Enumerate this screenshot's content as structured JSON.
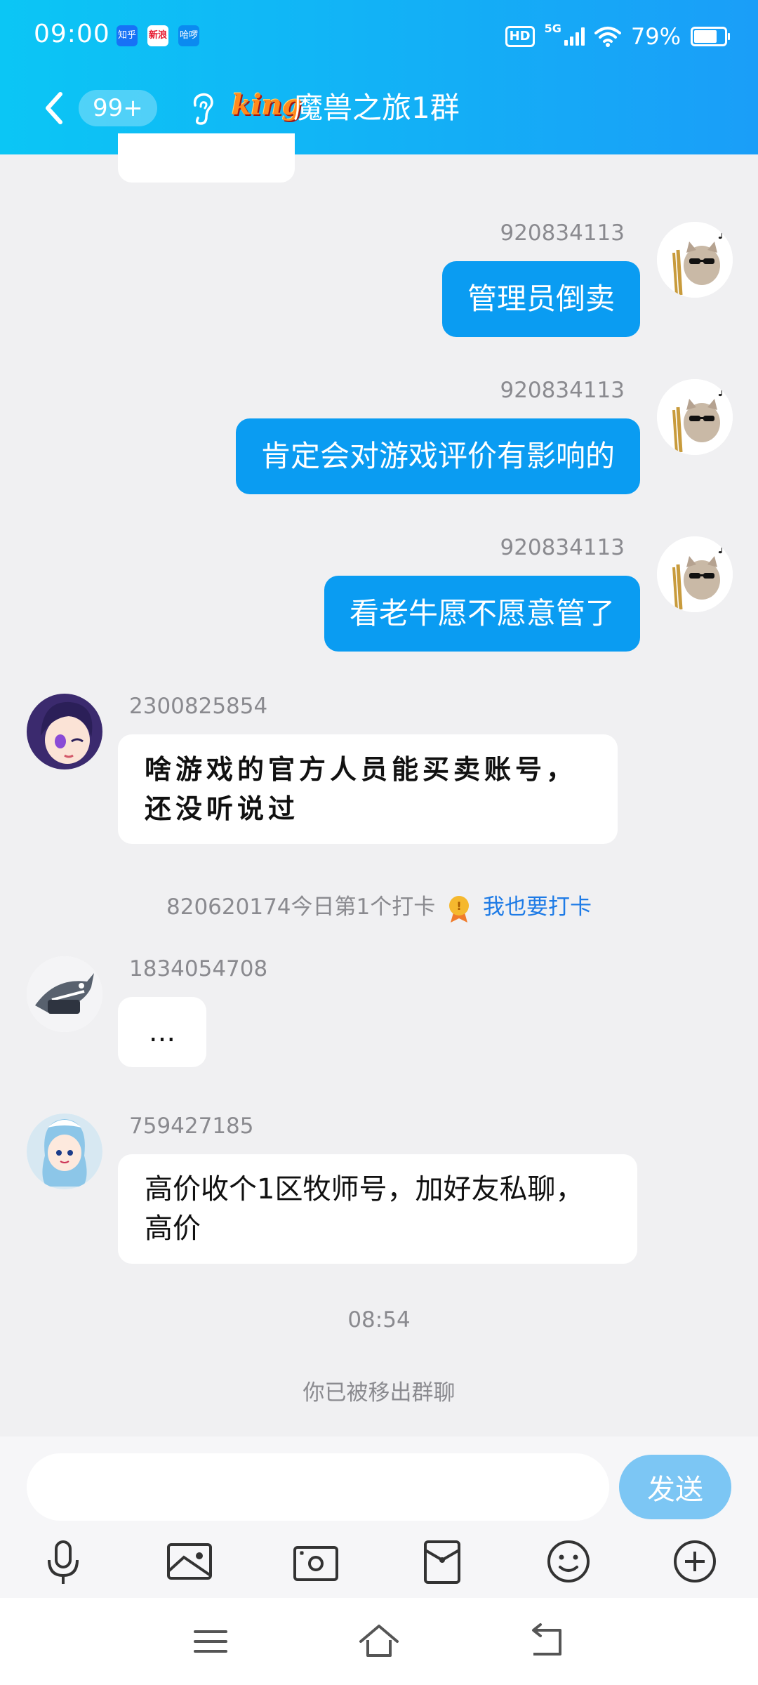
{
  "status_bar": {
    "time": "09:00",
    "apps": [
      "知乎",
      "新浪",
      "哈啰"
    ],
    "hd": "HD",
    "network": "5G",
    "battery": "79%"
  },
  "header": {
    "unread_count": "99+",
    "logo_text": "king",
    "group_name": "魔兽之旅1群"
  },
  "messages": [
    {
      "sender": "920834113",
      "text": "管理员倒卖",
      "outgoing": true
    },
    {
      "sender": "920834113",
      "text": "肯定会对游戏评价有影响的",
      "outgoing": true
    },
    {
      "sender": "920834113",
      "text": "看老牛愿不愿意管了",
      "outgoing": true
    },
    {
      "sender": "2300825854",
      "text": "啥游戏的官方人员能买卖账号，还没听说过",
      "outgoing": false
    },
    {
      "sender": "1834054708",
      "text": "...",
      "outgoing": false
    },
    {
      "sender": "759427185",
      "text": "高价收个1区牧师号，加好友私聊，高价",
      "outgoing": false
    }
  ],
  "checkin": {
    "text": "820620174今日第1个打卡",
    "link": "我也要打卡"
  },
  "timestamp": "08:54",
  "system_notice": "你已被移出群聊",
  "input": {
    "placeholder": "",
    "send_label": "发送"
  },
  "colors": {
    "header_gradient_start": "#0bc6f5",
    "header_gradient_end": "#1a9ef8",
    "outgoing_bubble": "#0a9cf2",
    "send_button": "#7cc6f4",
    "link": "#1e7be6"
  }
}
